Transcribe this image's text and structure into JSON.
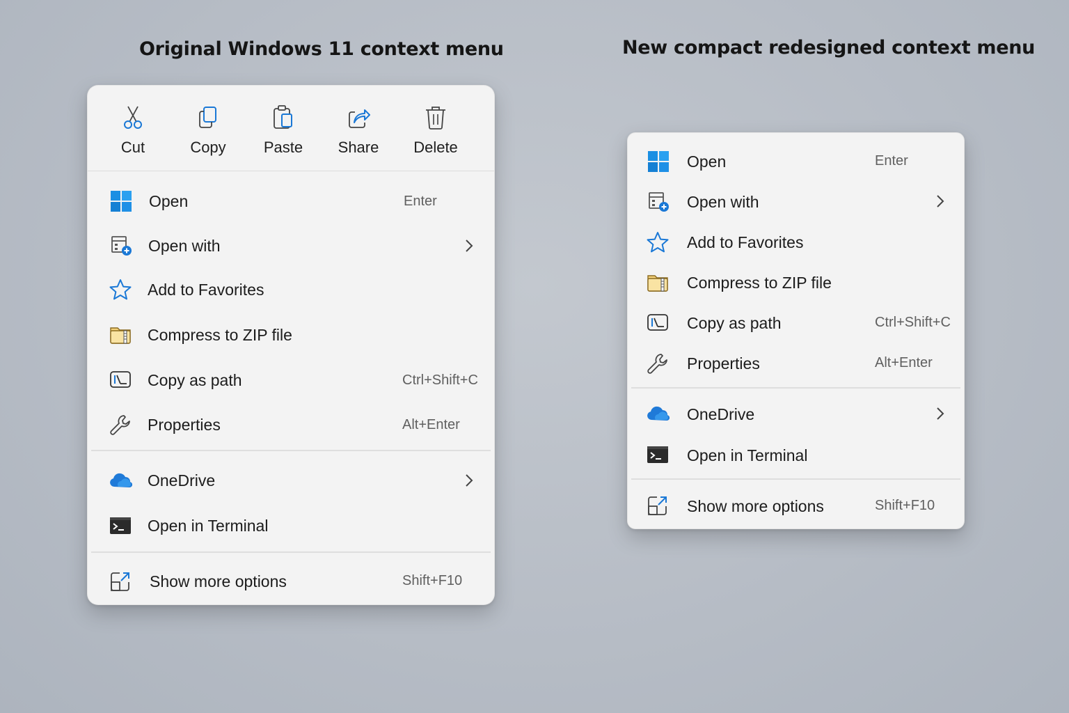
{
  "headings": {
    "left": "Original Windows 11 context menu",
    "right": "New compact redesigned context menu"
  },
  "colors": {
    "background": "#b8bec7",
    "menu": "#f3f3f3",
    "accent_blue": "#1a78d6",
    "folder_yellow": "#f2c75c"
  },
  "original_menu": {
    "toolbar": [
      {
        "label": "Cut",
        "icon": "scissors-icon"
      },
      {
        "label": "Copy",
        "icon": "copy-icon"
      },
      {
        "label": "Paste",
        "icon": "paste-icon"
      },
      {
        "label": "Share",
        "icon": "share-icon"
      },
      {
        "label": "Delete",
        "icon": "trash-icon"
      }
    ],
    "items": [
      {
        "label": "Open",
        "shortcut": "Enter",
        "icon": "windows-logo-icon"
      },
      {
        "label": "Open with",
        "shortcut": "",
        "icon": "open-with-icon",
        "submenu": true
      },
      {
        "label": "Add to Favorites",
        "shortcut": "",
        "icon": "star-icon"
      },
      {
        "label": "Compress to ZIP file",
        "shortcut": "",
        "icon": "zip-folder-icon"
      },
      {
        "label": "Copy as path",
        "shortcut": "Ctrl+Shift+C",
        "icon": "copy-path-icon"
      },
      {
        "label": "Properties",
        "shortcut": "Alt+Enter",
        "icon": "wrench-icon"
      },
      {
        "label": "OneDrive",
        "shortcut": "",
        "icon": "onedrive-cloud-icon",
        "submenu": true
      },
      {
        "label": "Open in Terminal",
        "shortcut": "",
        "icon": "terminal-icon"
      },
      {
        "label": "Show more options",
        "shortcut": "Shift+F10",
        "icon": "show-more-icon"
      }
    ]
  },
  "compact_menu": {
    "items": [
      {
        "label": "Open",
        "shortcut": "Enter",
        "icon": "windows-logo-icon"
      },
      {
        "label": "Open with",
        "shortcut": "",
        "icon": "open-with-icon",
        "submenu": true
      },
      {
        "label": "Add to Favorites",
        "shortcut": "",
        "icon": "star-icon"
      },
      {
        "label": "Compress to ZIP file",
        "shortcut": "",
        "icon": "zip-folder-icon"
      },
      {
        "label": "Copy as path",
        "shortcut": "Ctrl+Shift+C",
        "icon": "copy-path-icon"
      },
      {
        "label": "Properties",
        "shortcut": "Alt+Enter",
        "icon": "wrench-icon"
      },
      {
        "label": "OneDrive",
        "shortcut": "",
        "icon": "onedrive-cloud-icon",
        "submenu": true
      },
      {
        "label": "Open in Terminal",
        "shortcut": "",
        "icon": "terminal-icon"
      },
      {
        "label": "Show more options",
        "shortcut": "Shift+F10",
        "icon": "show-more-icon"
      }
    ]
  }
}
